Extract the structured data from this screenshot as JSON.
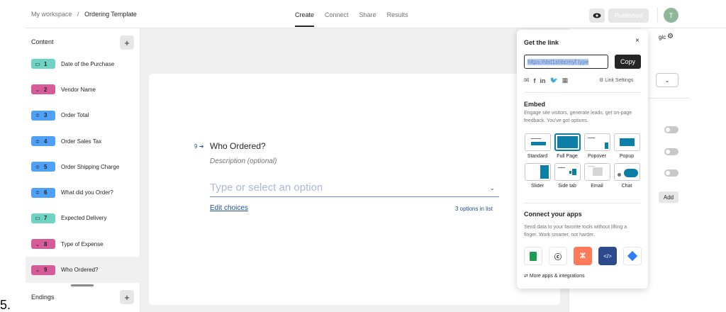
{
  "outer_prefix": "5.",
  "topbar": {
    "workspace": "My workspace",
    "separator": "/",
    "form_name": "Ordering Template",
    "tabs": [
      "Create",
      "Connect",
      "Share",
      "Results"
    ],
    "published_label": "Published",
    "avatar_initial": "T"
  },
  "sidebar": {
    "content_label": "Content",
    "add_label": "+",
    "endings_label": "Endings",
    "items": [
      {
        "num": "1",
        "label": "Date of the Purchase",
        "icon": "calendar-icon",
        "color": "#6fd3c3"
      },
      {
        "num": "2",
        "label": "Vendor Name",
        "icon": "chevron-down-icon",
        "color": "#d65c99"
      },
      {
        "num": "3",
        "label": "Order Total",
        "icon": "number-icon",
        "color": "#4fa1f7"
      },
      {
        "num": "4",
        "label": "Order Sales Tax",
        "icon": "number-icon",
        "color": "#4fa1f7"
      },
      {
        "num": "5",
        "label": "Order Shipping Charge",
        "icon": "number-icon",
        "color": "#4fa1f7"
      },
      {
        "num": "6",
        "label": "What did you Order?",
        "icon": "sliders-icon",
        "color": "#4fa1f7"
      },
      {
        "num": "7",
        "label": "Expected Delivery",
        "icon": "calendar-icon",
        "color": "#6fd3c3"
      },
      {
        "num": "8",
        "label": "Type of Expense",
        "icon": "chevron-down-icon",
        "color": "#d65c99"
      },
      {
        "num": "9",
        "label": "Who Ordered?",
        "icon": "chevron-down-icon",
        "color": "#d65c99"
      }
    ]
  },
  "question": {
    "number": "9",
    "title": "Who Ordered?",
    "description_placeholder": "Description (optional)",
    "input_placeholder": "Type or select an option",
    "edit_choices": "Edit choices",
    "options_count": "3 options in list"
  },
  "right_panel": {
    "partial_tab": "gic",
    "add_label": "Add"
  },
  "popover": {
    "title": "Get the link",
    "close": "×",
    "link_value": "https://dxt1shbcmyf.type",
    "copy_label": "Copy",
    "link_settings": "Link Settings",
    "embed_title": "Embed",
    "embed_desc": "Engage site visitors, generate leads, get on-page feedback. You've got options.",
    "embed_options": [
      "Standard",
      "Full Page",
      "Popover",
      "Popup",
      "Slider",
      "Side tab",
      "Email",
      "Chat"
    ],
    "connect_title": "Connect your apps",
    "connect_desc": "Send data to your favorite tools without lifting a finger. Work smarter, not harder.",
    "apps": [
      {
        "name": "google-sheets-icon",
        "color": "#1f9d55"
      },
      {
        "name": "mailchimp-icon",
        "color": "#ffffff"
      },
      {
        "name": "hubspot-icon",
        "color": "#ff7a59"
      },
      {
        "name": "embed-code-icon",
        "color": "#2e4a8c"
      },
      {
        "name": "jira-icon",
        "color": "#ffffff"
      }
    ],
    "more_apps": "More apps & integrations"
  }
}
